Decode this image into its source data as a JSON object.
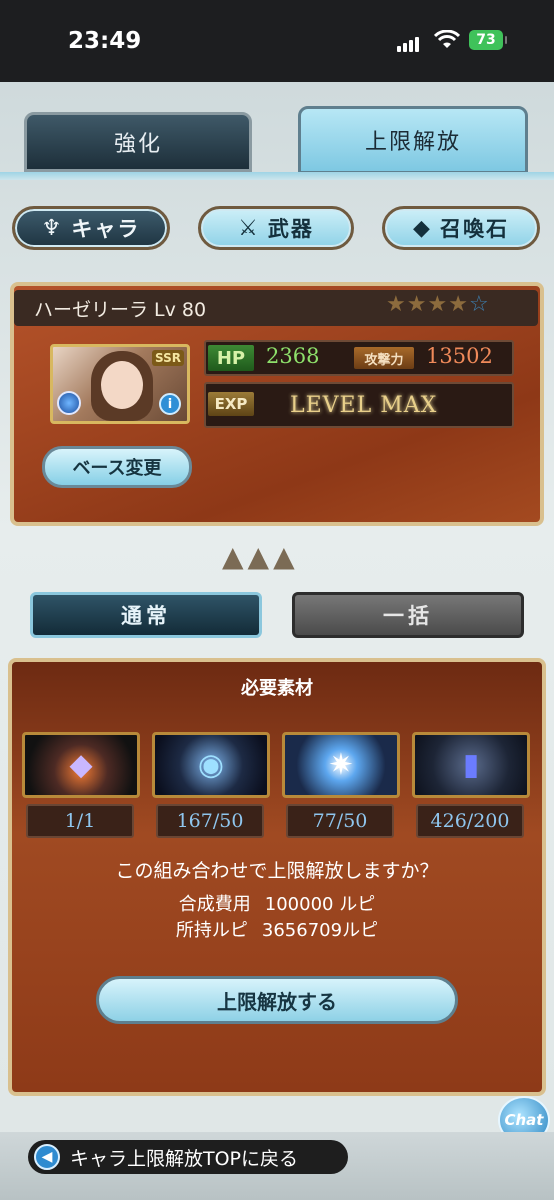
{
  "status_bar": {
    "time": "23:49",
    "battery": "73"
  },
  "tabs": [
    {
      "label": "強化",
      "active": false
    },
    {
      "label": "上限解放",
      "active": true
    }
  ],
  "categories": [
    {
      "label": "キャラ",
      "icon": "character-icon",
      "active": true
    },
    {
      "label": "武器",
      "icon": "weapon-icon",
      "active": false
    },
    {
      "label": "召喚石",
      "icon": "summon-stone-icon",
      "active": false
    }
  ],
  "character": {
    "name_level": "ハーゼリーラ Lv 80",
    "rarity": "SSR",
    "stars_filled": 4,
    "stars_total": 5,
    "hp_label": "HP",
    "hp": "2368",
    "atk_label": "攻撃力",
    "atk": "13502",
    "exp_label": "EXP",
    "exp_status": "LEVEL MAX",
    "base_change_label": "ベース変更"
  },
  "modes": {
    "normal": "通常",
    "bulk": "一括"
  },
  "materials": {
    "title": "必要素材",
    "items": [
      {
        "count": "1/1",
        "icon": "crystal-icon"
      },
      {
        "count": "167/50",
        "icon": "orb-icon"
      },
      {
        "count": "77/50",
        "icon": "star-burst-icon"
      },
      {
        "count": "426/200",
        "icon": "prism-icon"
      }
    ]
  },
  "confirm_text": "この組み合わせで上限解放しますか？",
  "cost": {
    "label": "合成費用",
    "value": "100000 ルピ"
  },
  "owned": {
    "label": "所持ルピ",
    "value": "3656709ルピ"
  },
  "confirm_button": "上限解放する",
  "chat_label": "Chat",
  "back_button": "キャラ上限解放TOPに戻る",
  "colors": {
    "accent": "#8ed1e6",
    "panel": "#8e3a18",
    "hp": "#8ee06b",
    "atk": "#f08a5a",
    "count": "#8fc6ee"
  }
}
